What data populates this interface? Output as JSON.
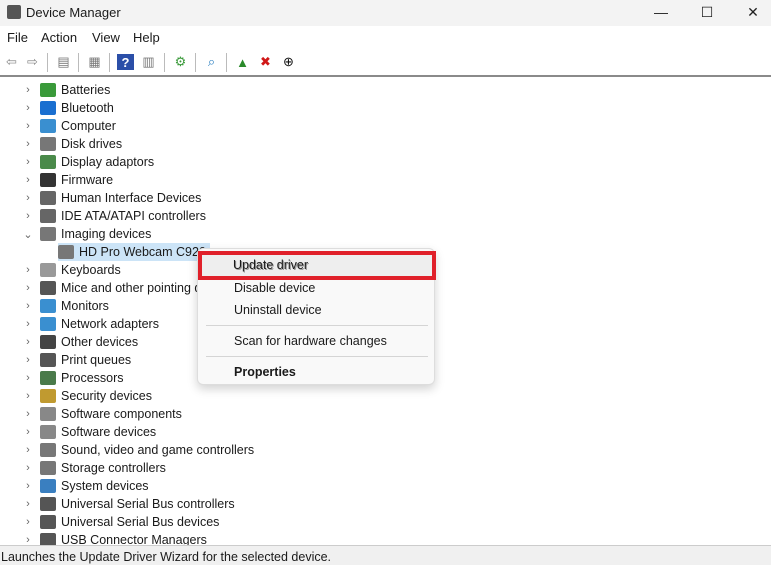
{
  "window": {
    "title": "Device Manager",
    "minimize": "—",
    "maximize": "☐",
    "close": "✕"
  },
  "menubar": [
    "File",
    "Action",
    "View",
    "Help"
  ],
  "toolbar": [
    {
      "icon": "back-icon",
      "glyph": "⇦",
      "color": "#888"
    },
    {
      "icon": "forward-icon",
      "glyph": "⇨",
      "color": "#888"
    },
    {
      "icon": "show-hide-console-tree-icon",
      "glyph": "▤",
      "color": "#777"
    },
    {
      "icon": "properties-icon",
      "glyph": "▦",
      "color": "#777"
    },
    {
      "icon": "help-icon",
      "glyph": "?",
      "color": "#fff",
      "bg": "#2b4fa8"
    },
    {
      "icon": "action-pane-icon",
      "glyph": "▥",
      "color": "#777"
    },
    {
      "icon": "update-driver-icon",
      "glyph": "⚙",
      "color": "#3a9a3a"
    },
    {
      "icon": "scan-hardware-icon",
      "glyph": "⌕",
      "color": "#2a7fc0"
    },
    {
      "icon": "add-driver-icon",
      "glyph": "▲",
      "color": "#2a8a2a"
    },
    {
      "icon": "uninstall-icon",
      "glyph": "✖",
      "color": "#d01818"
    },
    {
      "icon": "disable-icon",
      "glyph": "⊕",
      "color": "#111"
    }
  ],
  "tree": [
    {
      "label": "Batteries",
      "color": "#3a9a3a"
    },
    {
      "label": "Bluetooth",
      "color": "#1a6fd0"
    },
    {
      "label": "Computer",
      "color": "#3a8fd0"
    },
    {
      "label": "Disk drives",
      "color": "#777"
    },
    {
      "label": "Display adaptors",
      "color": "#4a8a4a"
    },
    {
      "label": "Firmware",
      "color": "#333"
    },
    {
      "label": "Human Interface Devices",
      "color": "#666"
    },
    {
      "label": "IDE ATA/ATAPI controllers",
      "color": "#666"
    },
    {
      "label": "Imaging devices",
      "color": "#777",
      "expanded": true
    },
    {
      "label": "HD Pro Webcam C920",
      "color": "#777",
      "child": true,
      "selected": true
    },
    {
      "label": "Keyboards",
      "color": "#999"
    },
    {
      "label": "Mice and other pointing devices",
      "color": "#555"
    },
    {
      "label": "Monitors",
      "color": "#3a8fd0"
    },
    {
      "label": "Network adapters",
      "color": "#3a8fd0"
    },
    {
      "label": "Other devices",
      "color": "#444"
    },
    {
      "label": "Print queues",
      "color": "#555"
    },
    {
      "label": "Processors",
      "color": "#4a7a4a"
    },
    {
      "label": "Security devices",
      "color": "#c09a30"
    },
    {
      "label": "Software components",
      "color": "#888"
    },
    {
      "label": "Software devices",
      "color": "#888"
    },
    {
      "label": "Sound, video and game controllers",
      "color": "#777"
    },
    {
      "label": "Storage controllers",
      "color": "#777"
    },
    {
      "label": "System devices",
      "color": "#3a7fc0"
    },
    {
      "label": "Universal Serial Bus controllers",
      "color": "#555"
    },
    {
      "label": "Universal Serial Bus devices",
      "color": "#555"
    },
    {
      "label": "USB Connector Managers",
      "color": "#555"
    }
  ],
  "context_menu": {
    "update": "Update driver",
    "disable": "Disable device",
    "uninstall": "Uninstall device",
    "scan": "Scan for hardware changes",
    "properties": "Properties",
    "highlight_color": "#e0202a"
  },
  "status": "Launches the Update Driver Wizard for the selected device."
}
